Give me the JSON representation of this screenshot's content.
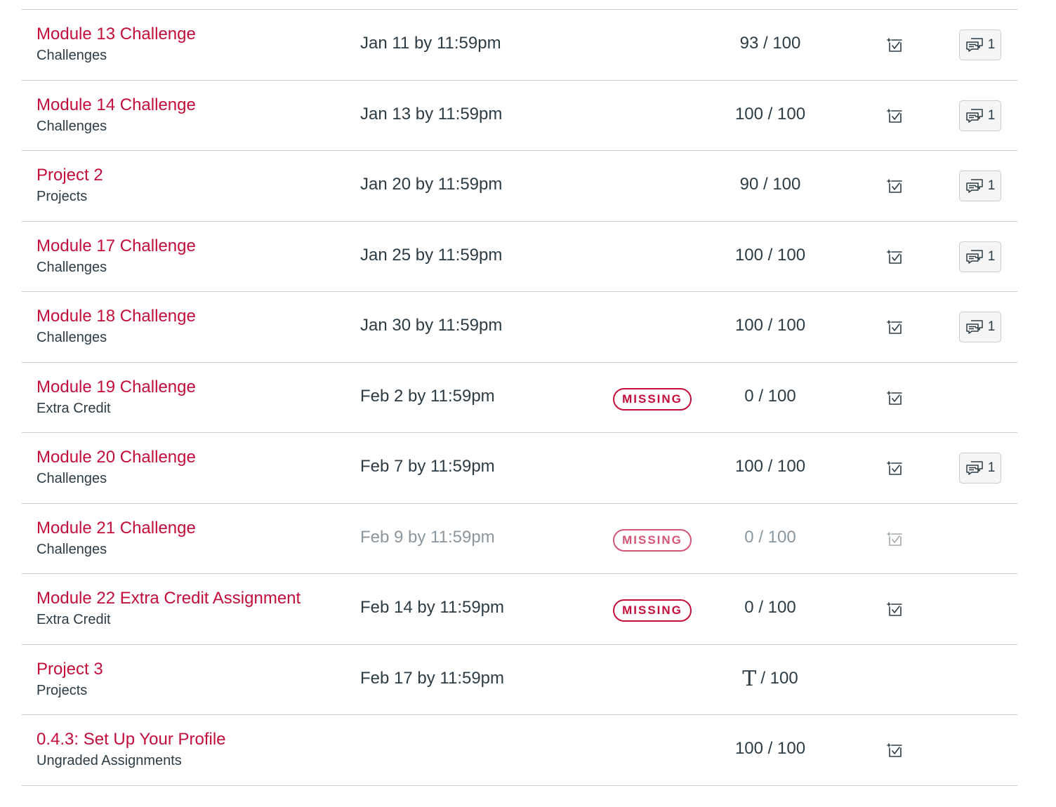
{
  "accent_color": "#c30e3b",
  "icons": {
    "rubric": "rubric-icon",
    "comments": "comments-icon",
    "text_entry": "text-entry-icon"
  },
  "assignments": [
    {
      "title": "Module 13 Challenge",
      "category": "Challenges",
      "due": "Jan 11 by 11:59pm",
      "status": "",
      "score": "93",
      "points_possible": "/ 100",
      "comments": "1"
    },
    {
      "title": "Module 14 Challenge",
      "category": "Challenges",
      "due": "Jan 13 by 11:59pm",
      "status": "",
      "score": "100",
      "points_possible": "/ 100",
      "comments": "1"
    },
    {
      "title": "Project 2",
      "category": "Projects",
      "due": "Jan 20 by 11:59pm",
      "status": "",
      "score": "90",
      "points_possible": "/ 100",
      "comments": "1"
    },
    {
      "title": "Module 17 Challenge",
      "category": "Challenges",
      "due": "Jan 25 by 11:59pm",
      "status": "",
      "score": "100",
      "points_possible": "/ 100",
      "comments": "1"
    },
    {
      "title": "Module 18 Challenge",
      "category": "Challenges",
      "due": "Jan 30 by 11:59pm",
      "status": "",
      "score": "100",
      "points_possible": "/ 100",
      "comments": "1"
    },
    {
      "title": "Module 19 Challenge",
      "category": "Extra Credit",
      "due": "Feb 2 by 11:59pm",
      "status": "MISSING",
      "score": "0",
      "points_possible": "/ 100",
      "comments": ""
    },
    {
      "title": "Module 20 Challenge",
      "category": "Challenges",
      "due": "Feb 7 by 11:59pm",
      "status": "",
      "score": "100",
      "points_possible": "/ 100",
      "comments": "1"
    },
    {
      "title": "Module 21 Challenge",
      "category": "Challenges",
      "due": "Feb 9 by 11:59pm",
      "status": "MISSING",
      "score": "0",
      "points_possible": "/ 100",
      "comments": "",
      "muted": true
    },
    {
      "title": "Module 22 Extra Credit Assignment",
      "category": "Extra Credit",
      "due": "Feb 14 by 11:59pm",
      "status": "MISSING",
      "score": "0",
      "points_possible": "/ 100",
      "comments": ""
    },
    {
      "title": "Project 3",
      "category": "Projects",
      "due": "Feb 17 by 11:59pm",
      "status": "",
      "score": "",
      "points_possible": "/ 100",
      "comments": "",
      "submission_type_icon": "text-entry-icon",
      "no_rubric": true
    },
    {
      "title": "0.4.3: Set Up Your Profile",
      "category": "Ungraded Assignments",
      "due": "",
      "status": "",
      "score": "100",
      "points_possible": "/ 100",
      "comments": ""
    }
  ]
}
